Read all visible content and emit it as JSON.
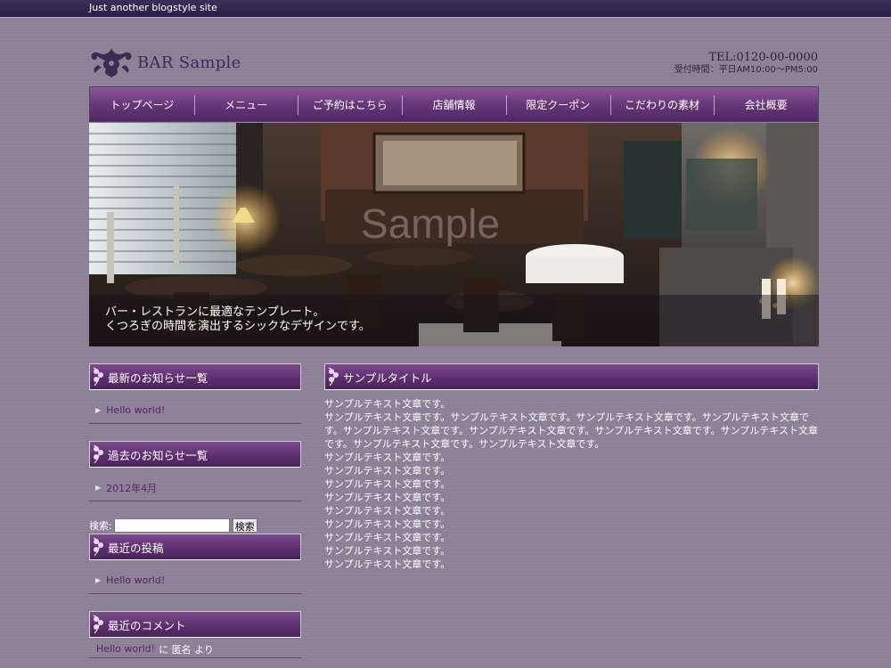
{
  "header": {
    "tagline": "Just another blogstyle site",
    "brand": "BAR Sample",
    "tel": "TEL:0120-00-0000",
    "hours": "受付時間：平日AM10:00～PM5:00"
  },
  "nav": {
    "items": [
      {
        "label": "トップページ"
      },
      {
        "label": "メニュー"
      },
      {
        "label": "ご予約はこちら"
      },
      {
        "label": "店舗情報"
      },
      {
        "label": "限定クーポン"
      },
      {
        "label": "こだわりの素材"
      },
      {
        "label": "会社概要"
      }
    ]
  },
  "hero": {
    "watermark": "Sample",
    "caption_line1": "バー・レストランに最適なテンプレート。",
    "caption_line2": "くつろぎの時間を演出するシックなデザインです。"
  },
  "sidebar": {
    "latest_title": "最新のお知らせ一覧",
    "latest_items": [
      {
        "label": "Hello world!"
      }
    ],
    "archive_title": "過去のお知らせ一覧",
    "archive_items": [
      {
        "label": "2012年4月"
      }
    ],
    "search_label": "検索:",
    "search_value": "",
    "search_button": "検索",
    "recent_posts_title": "最近の投稿",
    "recent_posts_items": [
      {
        "label": "Hello world!"
      }
    ],
    "recent_comments_title": "最近のコメント",
    "recent_comment": {
      "link": "Hello world!",
      "text": "に 匿名 より"
    }
  },
  "main": {
    "title": "サンプルタイトル",
    "paragraphs": [
      "サンプルテキスト文章です。",
      "サンプルテキスト文章です。サンプルテキスト文章です。サンプルテキスト文章です。サンプルテキスト文章です。サンプルテキスト文章です。サンプルテキスト文章です。サンプルテキスト文章です。サンプルテキスト文章です。サンプルテキスト文章です。サンプルテキスト文章です。",
      "サンプルテキスト文章です。",
      "サンプルテキスト文章です。",
      "サンプルテキスト文章です。",
      "サンプルテキスト文章です。",
      "サンプルテキスト文章です。",
      "サンプルテキスト文章です。",
      "サンプルテキスト文章です。",
      "サンプルテキスト文章です。",
      "サンプルテキスト文章です。"
    ]
  },
  "colors": {
    "background": "#8d8297",
    "accent_purple": "#5e2f70",
    "link": "#5a1e6a"
  }
}
